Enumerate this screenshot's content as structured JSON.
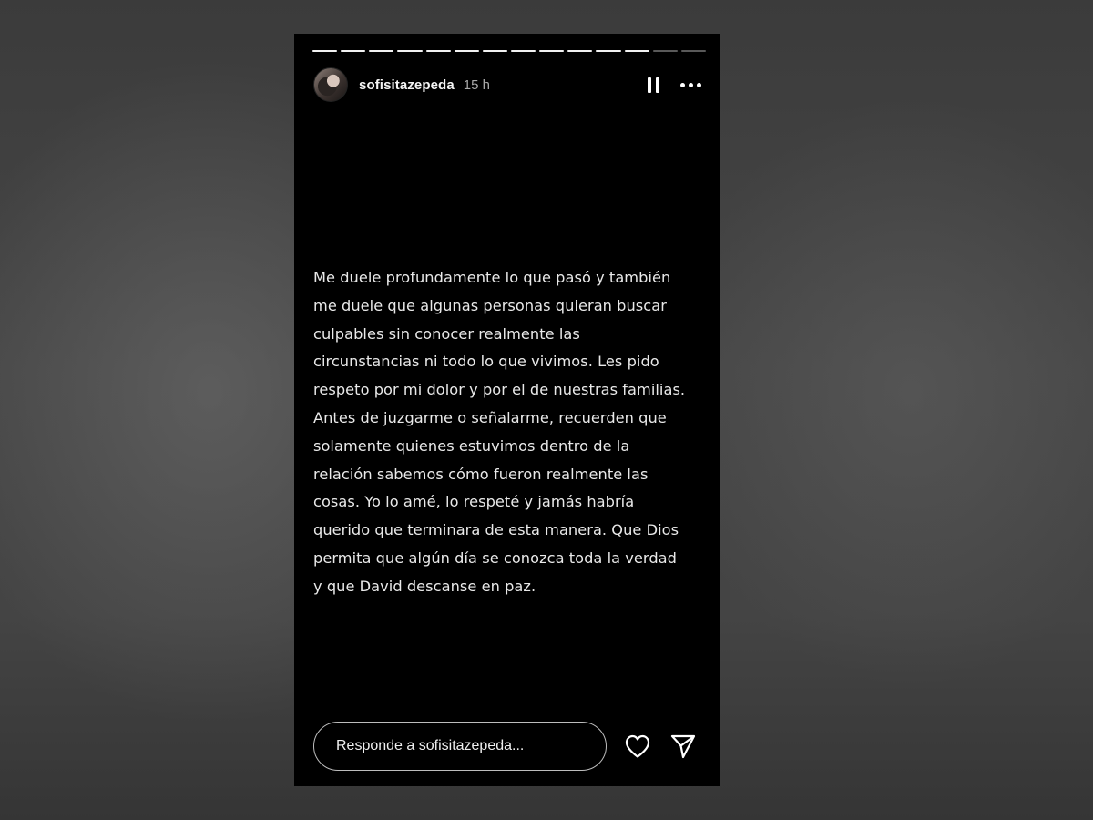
{
  "story": {
    "progress": {
      "segments_total": 14,
      "segments_completed": 12
    },
    "header": {
      "username": "sofisitazepeda",
      "time_ago": "15 h",
      "avatar_icon": "profile-photo",
      "pause_icon": "pause-icon",
      "more_icon": "more-options-icon"
    },
    "message_lines": [
      "Me duele profundamente lo que pasó y también",
      "me duele que algunas personas quieran buscar",
      "culpables sin conocer realmente las",
      "circunstancias ni todo lo que vivimos. Les pido",
      "respeto por mi dolor y por el de nuestras familias.",
      "Antes de juzgarme o señalarme, recuerden que",
      "solamente quienes estuvimos dentro de la",
      "relación sabemos cómo fueron realmente las",
      "cosas. Yo lo amé, lo respeté y jamás habría",
      "querido que terminara de esta manera. Que Dios",
      "permita que algún día se conozca toda la verdad",
      "y que David descanse en paz."
    ],
    "footer": {
      "reply_placeholder": "Responde a sofisitazepeda...",
      "reply_value": "",
      "like_icon": "heart-icon",
      "share_icon": "send-icon"
    }
  },
  "colors": {
    "story_background": "#000000",
    "text": "#e9e9e9",
    "backdrop": "#444444"
  }
}
